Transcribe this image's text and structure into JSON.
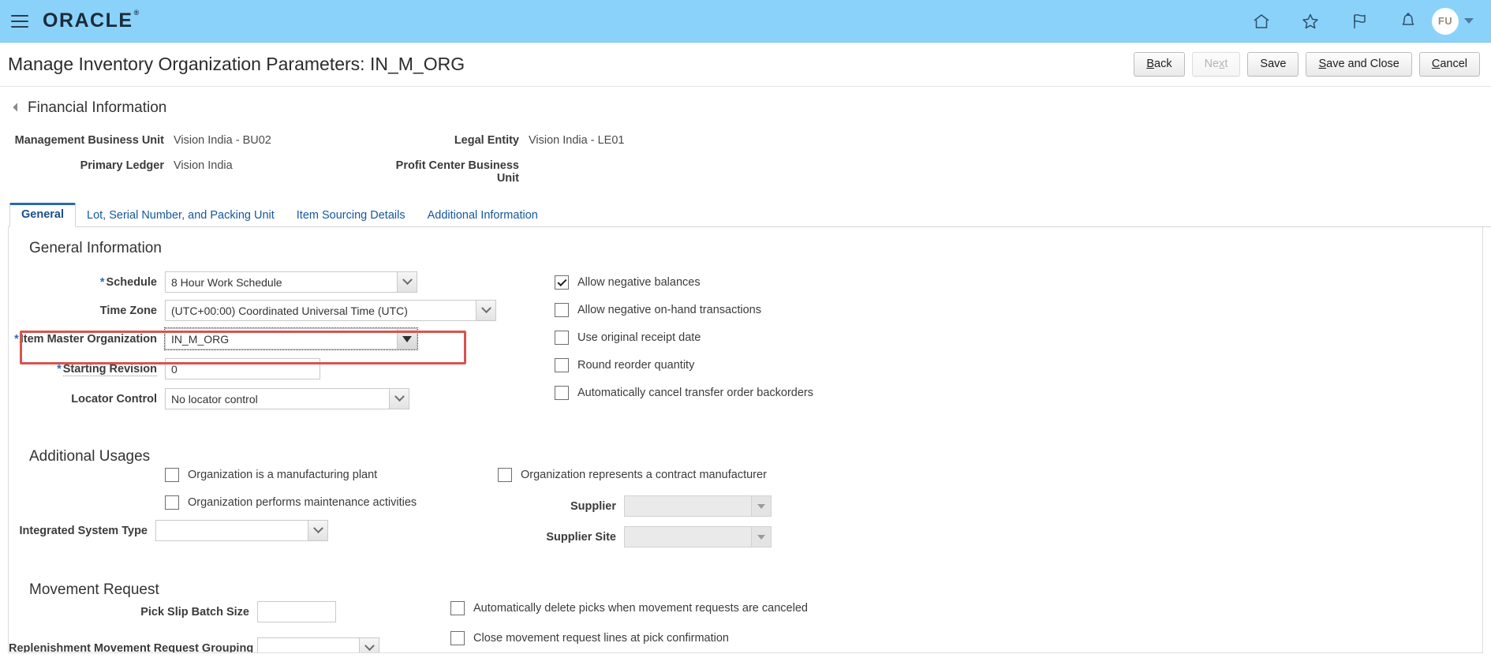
{
  "header": {
    "menu_icon": "hamburger-icon",
    "logo": "ORACLE",
    "logo_tm": "®",
    "icons": [
      {
        "name": "home-icon",
        "label": "Home"
      },
      {
        "name": "favorites-star-icon",
        "label": "Favorites"
      },
      {
        "name": "flag-icon",
        "label": "Watchlist"
      },
      {
        "name": "bell-icon",
        "label": "Notifications"
      }
    ],
    "avatar_initials": "FU",
    "accent_color": "#8ad2fa"
  },
  "page": {
    "title": "Manage Inventory Organization Parameters: IN_M_ORG",
    "buttons": [
      {
        "name": "back-button",
        "label": "Back",
        "accel": "B",
        "disabled": false
      },
      {
        "name": "next-button",
        "label": "Next",
        "accel": "x",
        "disabled": true
      },
      {
        "name": "save-button",
        "label": "Save",
        "accel": "",
        "disabled": false
      },
      {
        "name": "save-and-close-button",
        "label": "Save and Close",
        "accel": "S",
        "disabled": false
      },
      {
        "name": "cancel-button",
        "label": "Cancel",
        "accel": "C",
        "disabled": false
      }
    ]
  },
  "financial": {
    "section_title": "Financial Information",
    "fields": [
      {
        "label": "Management Business Unit",
        "value": "Vision India - BU02"
      },
      {
        "label": "Legal Entity",
        "value": "Vision India - LE01"
      },
      {
        "label": "Primary Ledger",
        "value": "Vision India"
      },
      {
        "label": "Profit Center Business Unit",
        "value": ""
      }
    ]
  },
  "tabs": [
    {
      "label": "General",
      "active": true
    },
    {
      "label": "Lot, Serial Number, and Packing Unit",
      "active": false
    },
    {
      "label": "Item Sourcing Details",
      "active": false
    },
    {
      "label": "Additional Information",
      "active": false
    }
  ],
  "general_information": {
    "title": "General Information",
    "schedule": {
      "label": "Schedule",
      "required": true,
      "value": "8 Hour Work Schedule"
    },
    "time_zone": {
      "label": "Time Zone",
      "required": false,
      "value": "(UTC+00:00) Coordinated Universal Time (UTC)"
    },
    "item_master_organization": {
      "label": "Item Master Organization",
      "required": true,
      "value": "IN_M_ORG",
      "highlighted": true,
      "highlight_color": "#d9534f"
    },
    "starting_revision": {
      "label": "Starting Revision",
      "required": true,
      "value": "0"
    },
    "locator_control": {
      "label": "Locator Control",
      "required": false,
      "value": "No locator control"
    },
    "checkboxes": [
      {
        "label": "Allow negative balances",
        "checked": true
      },
      {
        "label": "Allow negative on-hand transactions",
        "checked": false
      },
      {
        "label": "Use original receipt date",
        "checked": false
      },
      {
        "label": "Round reorder quantity",
        "checked": false
      },
      {
        "label": "Automatically cancel transfer order backorders",
        "checked": false
      }
    ]
  },
  "additional_usages": {
    "title": "Additional Usages",
    "checkbox_manufacturing_plant": {
      "label": "Organization is a manufacturing plant",
      "checked": false
    },
    "checkbox_maintenance_activities": {
      "label": "Organization performs maintenance activities",
      "checked": false
    },
    "checkbox_contract_manufacturer": {
      "label": "Organization represents a contract manufacturer",
      "checked": false
    },
    "integrated_system_type": {
      "label": "Integrated System Type",
      "value": "",
      "disabled": false
    },
    "supplier": {
      "label": "Supplier",
      "value": "",
      "disabled": true
    },
    "supplier_site": {
      "label": "Supplier Site",
      "value": "",
      "disabled": true
    }
  },
  "movement_request": {
    "title": "Movement Request",
    "pick_slip_batch_size": {
      "label": "Pick Slip Batch Size",
      "value": ""
    },
    "replenishment_grouping": {
      "label": "Replenishment Movement Request Grouping",
      "value": ""
    },
    "checkbox_auto_delete_picks": {
      "label": "Automatically delete picks when movement requests are canceled",
      "checked": false
    },
    "checkbox_close_lines": {
      "label": "Close movement request lines at pick confirmation",
      "checked": false
    }
  }
}
